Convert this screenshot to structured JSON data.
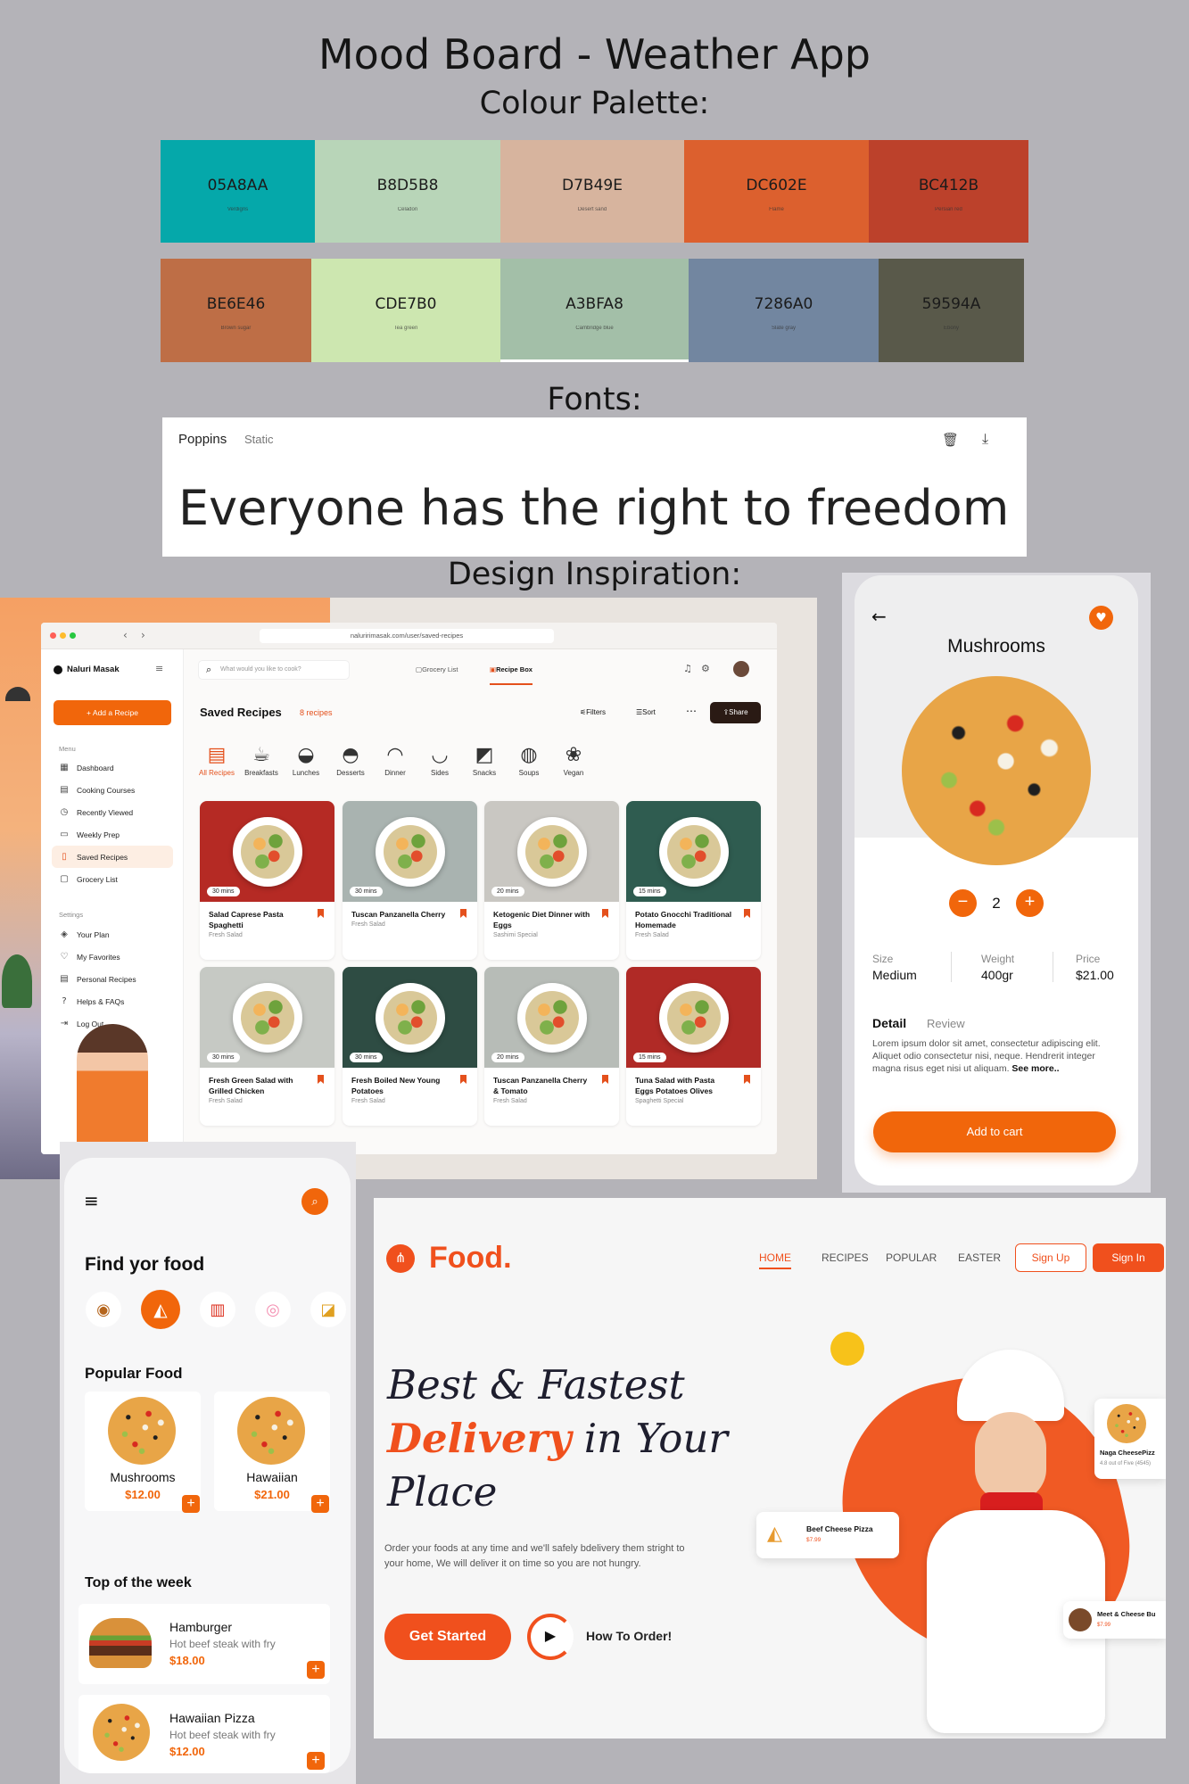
{
  "title": "Mood Board - Weather App",
  "palette_heading": "Colour Palette:",
  "palette_row1": [
    {
      "hex": "05A8AA",
      "name": "Verdigris",
      "color": "#05A8AA"
    },
    {
      "hex": "B8D5B8",
      "name": "Celadon",
      "color": "#B8D5B8"
    },
    {
      "hex": "D7B49E",
      "name": "Desert sand",
      "color": "#D7B49E"
    },
    {
      "hex": "DC602E",
      "name": "Flame",
      "color": "#DC602E"
    },
    {
      "hex": "BC412B",
      "name": "Persian red",
      "color": "#BC412B"
    }
  ],
  "palette_row2": [
    {
      "hex": "BE6E46",
      "name": "Brown sugar",
      "color": "#BE6E46"
    },
    {
      "hex": "CDE7B0",
      "name": "Tea green",
      "color": "#CDE7B0"
    },
    {
      "hex": "A3BFA8",
      "name": "Cambridge blue",
      "color": "#A3BFA8"
    },
    {
      "hex": "7286A0",
      "name": "Slate gray",
      "color": "#7286A0"
    },
    {
      "hex": "59594A",
      "name": "Ebony",
      "color": "#59594A"
    }
  ],
  "fonts_heading": "Fonts:",
  "font_card": {
    "font_name": "Poppins",
    "style": "Static",
    "sample": "Everyone has the right to freedom c"
  },
  "inspiration_heading": "Design Inspiration:",
  "recipe_app": {
    "url": "naluririmasak.com/user/saved-recipes",
    "brand": "Naluri Masak",
    "add_button": "+ Add a Recipe",
    "menu_label": "Menu",
    "menu": [
      "Dashboard",
      "Cooking Courses",
      "Recently Viewed",
      "Weekly Prep",
      "Saved Recipes",
      "Grocery List"
    ],
    "settings_label": "Settings",
    "settings": [
      "Your Plan",
      "My Favorites",
      "Personal Recipes",
      "Helps & FAQs",
      "Log Out"
    ],
    "search_placeholder": "What would you like to cook?",
    "grocery_tab": "Grocery List",
    "recipe_box_tab": "Recipe Box",
    "page_title": "Saved Recipes",
    "count": "8 recipes",
    "filters": "Filters",
    "sort": "Sort",
    "share": "Share",
    "categories": [
      "All Recipes",
      "Breakfasts",
      "Lunches",
      "Desserts",
      "Dinner",
      "Sides",
      "Snacks",
      "Soups",
      "Vegan"
    ],
    "recipes": [
      {
        "title": "Salad Caprese Pasta Spaghetti",
        "sub": "Fresh Salad",
        "time": "30 mins",
        "bg": "#b52a24"
      },
      {
        "title": "Tuscan Panzanella Cherry",
        "sub": "Fresh Salad",
        "time": "30 mins",
        "bg": "#a9b3b0"
      },
      {
        "title": "Ketogenic Diet Dinner with Eggs",
        "sub": "Sashimi Special",
        "time": "20 mins",
        "bg": "#c9c7c2"
      },
      {
        "title": "Potato Gnocchi Traditional Homemade",
        "sub": "Fresh Salad",
        "time": "15 mins",
        "bg": "#2f5c50"
      },
      {
        "title": "Fresh Green Salad with Grilled Chicken",
        "sub": "Fresh Salad",
        "time": "30 mins",
        "bg": "#c6c9c4"
      },
      {
        "title": "Fresh Boiled New Young Potatoes",
        "sub": "Fresh Salad",
        "time": "30 mins",
        "bg": "#2e4c43"
      },
      {
        "title": "Tuscan Panzanella Cherry & Tomato",
        "sub": "Fresh Salad",
        "time": "20 mins",
        "bg": "#b7bcb7"
      },
      {
        "title": "Tuna Salad with Pasta Eggs Potatoes Olives",
        "sub": "Spaghetti Special",
        "time": "15 mins",
        "bg": "#b02a26"
      }
    ]
  },
  "pizza_detail": {
    "title": "Mushrooms",
    "qty": "2",
    "size_label": "Size",
    "size": "Medium",
    "weight_label": "Weight",
    "weight": "400gr",
    "price_label": "Price",
    "price": "$21.00",
    "tab_detail": "Detail",
    "tab_review": "Review",
    "desc": "Lorem ipsum dolor sit amet, consectetur adipiscing elit. Aliquet odio consectetur nisi, neque. Hendrerit integer magna risus eget nisi ut aliquam.",
    "see_more": "See more..",
    "cta": "Add to cart"
  },
  "food_mobile": {
    "heading": "Find yor food",
    "popular": "Popular Food",
    "items": [
      {
        "name": "Mushrooms",
        "price": "$12.00"
      },
      {
        "name": "Hawaiian",
        "price": "$21.00"
      }
    ],
    "top_week": "Top of the week",
    "list": [
      {
        "name": "Hamburger",
        "desc": "Hot beef steak with fry",
        "price": "$18.00"
      },
      {
        "name": "Hawaiian Pizza",
        "desc": "Hot beef steak with fry",
        "price": "$12.00"
      }
    ]
  },
  "food_web": {
    "logo": "Food.",
    "nav": [
      "HOME",
      "RECIPES",
      "POPULAR",
      "EASTER"
    ],
    "signup": "Sign Up",
    "signin": "Sign In",
    "headline_1": "Best & Fastest",
    "headline_2a": "Delivery",
    "headline_2b": " in Your",
    "headline_3": "Place",
    "body": "Order your foods at any time and we'll safely bdelivery them stright to your home, We will deliver it on time so you are not hungry.",
    "cta": "Get Started",
    "how": "How To Order!",
    "chip1_title": "Beef Cheese Pizza",
    "chip1_price": "$7.99",
    "chip2_title": "Naga CheesePizz",
    "chip2_rating": "4.8 out of Five (4545)",
    "chip3_title": "Meet & Cheese Bu",
    "chip3_price": "$7.99"
  }
}
